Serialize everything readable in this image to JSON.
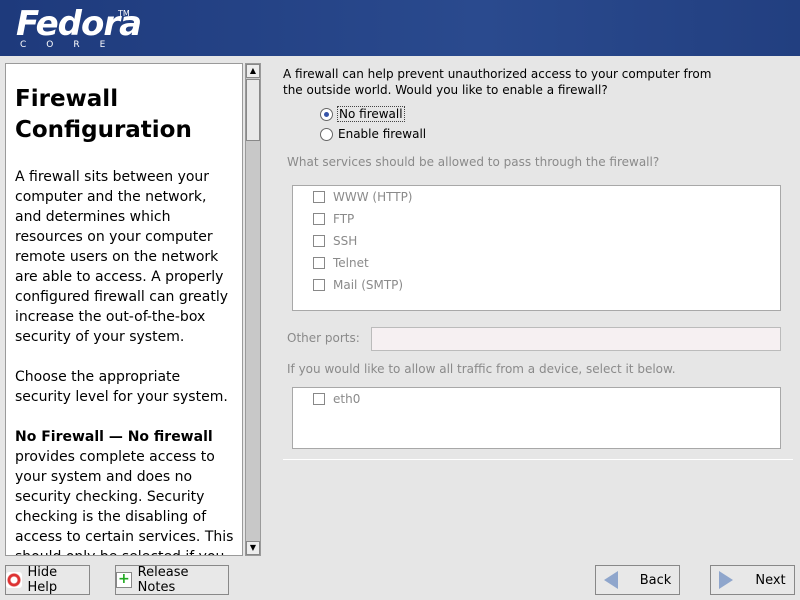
{
  "header": {
    "logo": "Fedora",
    "logo_tm": "TM",
    "logo_sub": "CORE"
  },
  "help": {
    "title": "Firewall Configuration",
    "paragraphs": [
      "A firewall sits between your computer and the network, and determines which resources on your computer remote users on the network are able to access. A properly configured firewall can greatly increase the out-of-the-box security of your system.",
      "Choose the appropriate security level for your system."
    ],
    "bold_lead": "No Firewall — No firewall",
    "last_paragraph": " provides complete access to your system and does no security checking. Security checking is the disabling of access to certain services. This should only be selected if you are running on a trusted"
  },
  "main": {
    "intro": "A firewall can help prevent unauthorized access to your computer from the outside world.  Would you like to enable a firewall?",
    "radios": [
      {
        "label": "No firewall",
        "selected": true
      },
      {
        "label": "Enable firewall",
        "selected": false
      }
    ],
    "services_label": "What services should be allowed to pass through the firewall?",
    "services": [
      "WWW (HTTP)",
      "FTP",
      "SSH",
      "Telnet",
      "Mail (SMTP)"
    ],
    "other_ports_label": "Other ports:",
    "other_ports_value": "",
    "device_label": "If you would like to allow all traffic from a device, select it below.",
    "devices": [
      "eth0"
    ]
  },
  "buttons": {
    "hide_help": "Hide Help",
    "release_notes": "Release Notes",
    "back": "Back",
    "next": "Next"
  },
  "colors": {
    "header": "#1e3a7c",
    "background": "#e6e6e6",
    "radio_selected": "#3654a8"
  }
}
